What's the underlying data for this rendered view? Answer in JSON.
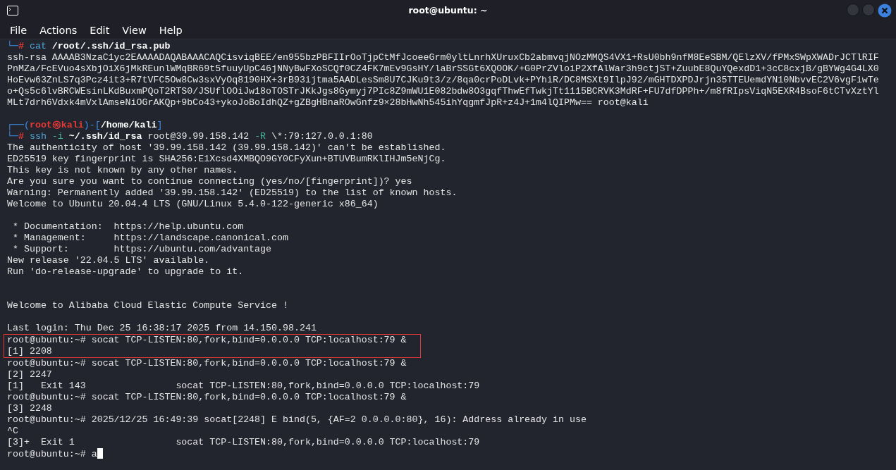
{
  "window": {
    "title": "root@ubuntu: ~"
  },
  "menu": [
    "File",
    "Actions",
    "Edit",
    "View",
    "Help"
  ],
  "terminal": {
    "cursor": true,
    "lines": [
      {
        "kind": "text",
        "highlighted": false,
        "segments": [
          {
            "kind": "frame",
            "text": "└─"
          },
          {
            "kind": "hash",
            "text": "# "
          },
          {
            "kind": "command",
            "text": "cat "
          },
          {
            "kind": "argument",
            "text": "/root/.ssh/id_rsa.pub"
          }
        ]
      },
      {
        "kind": "text",
        "highlighted": false,
        "segments": [
          {
            "kind": "plain",
            "text": "ssh-rsa AAAAB3NzaC1yc2EAAAADAQABAAACAQCisviqBEE/en955bzPBFIIrOoTjpCtMfJcoeeGrm0yltLnrhXUruxCb2abmvqjNOzMMQS4VX1+RsU0bh9nfM8EeSBM/QElzXV/fPMxSWpXWADrJCTlRIF"
          }
        ]
      },
      {
        "kind": "text",
        "highlighted": false,
        "segments": [
          {
            "kind": "plain",
            "text": "PnMZa/FcEVuo4sXbjOiX6jMkREunlWMqBR69t5fuuyUpC46jNNyBwFXoSCQf0CZ4FK7mEv9GsHY/laBrSSGt6XQOOK/+G0PrZVloiP2XfAlWar3h9ctjST+ZuubE8QuYQexdD1+3cC8cxjB/gBYWg4G4LX0"
          }
        ]
      },
      {
        "kind": "text",
        "highlighted": false,
        "segments": [
          {
            "kind": "plain",
            "text": "HoEvw63ZnLS7q3Pcz4it3+R7tVFC5Ow8Cw3sxVyOq8190HX+3rB93ijtma5AADLesSm8U7CJKu9t3/z/8qa0crPoDLvk+PYhiR/DC8MSXt9IlpJ92/mGHTDXPDJrjn35TTEUemdYN10NbvvEC2V6vgFiwTe"
          }
        ]
      },
      {
        "kind": "text",
        "highlighted": false,
        "segments": [
          {
            "kind": "plain",
            "text": "o+Qs5c6lvBRCWEsinLKdBuxmPQoT2RTS0/JSUflOOiJw18oTOSTrJKkJgs8Gymyj7PIc8Z9mWU1E082bdw8O3gqfThwEfTwkjTt1115BCRVK3MdRF+FU7dfDPPh+/m8fRIpsViqN5EXR4BsoF6tCTvXztYl"
          }
        ]
      },
      {
        "kind": "text",
        "highlighted": false,
        "segments": [
          {
            "kind": "plain",
            "text": "MLt7drh6Vdxk4mVxlAmseNiOGrAKQp+9bCo43+ykoJoBoIdhQZ+gZBgHBnaROwGnfz9×28bHwNh545ihYqgmfJpR+z4J+1m4lQIPMw== root@kali"
          }
        ]
      },
      {
        "kind": "blank",
        "highlighted": false
      },
      {
        "kind": "text",
        "highlighted": false,
        "segments": [
          {
            "kind": "frame",
            "text": "┌──("
          },
          {
            "kind": "user",
            "text": "root㉿kali"
          },
          {
            "kind": "frame",
            "text": ")-["
          },
          {
            "kind": "argument",
            "text": "/home/kali"
          },
          {
            "kind": "frame",
            "text": "]"
          }
        ]
      },
      {
        "kind": "text",
        "highlighted": false,
        "segments": [
          {
            "kind": "frame",
            "text": "└─"
          },
          {
            "kind": "hash",
            "text": "# "
          },
          {
            "kind": "command",
            "text": "ssh "
          },
          {
            "kind": "option",
            "text": "-i "
          },
          {
            "kind": "argument",
            "text": "~/.ssh/id_rsa"
          },
          {
            "kind": "plain",
            "text": " root@39.99.158.142 "
          },
          {
            "kind": "option",
            "text": "-R "
          },
          {
            "kind": "plain",
            "text": "\\*:79:127.0.0.1:80"
          }
        ]
      },
      {
        "kind": "text",
        "highlighted": false,
        "segments": [
          {
            "kind": "plain",
            "text": "The authenticity of host '39.99.158.142 (39.99.158.142)' can't be established."
          }
        ]
      },
      {
        "kind": "text",
        "highlighted": false,
        "segments": [
          {
            "kind": "plain",
            "text": "ED25519 key fingerprint is SHA256:E1Xcsd4XMBQO9GY0CFyXun+BTUVBumRKlIHJm5eNjCg."
          }
        ]
      },
      {
        "kind": "text",
        "highlighted": false,
        "segments": [
          {
            "kind": "plain",
            "text": "This key is not known by any other names."
          }
        ]
      },
      {
        "kind": "text",
        "highlighted": false,
        "segments": [
          {
            "kind": "plain",
            "text": "Are you sure you want to continue connecting (yes/no/[fingerprint])? yes"
          }
        ]
      },
      {
        "kind": "text",
        "highlighted": false,
        "segments": [
          {
            "kind": "plain",
            "text": "Warning: Permanently added '39.99.158.142' (ED25519) to the list of known hosts."
          }
        ]
      },
      {
        "kind": "text",
        "highlighted": false,
        "segments": [
          {
            "kind": "plain",
            "text": "Welcome to Ubuntu 20.04.4 LTS (GNU/Linux 5.4.0-122-generic x86_64)"
          }
        ]
      },
      {
        "kind": "blank",
        "highlighted": false
      },
      {
        "kind": "text",
        "highlighted": false,
        "segments": [
          {
            "kind": "plain",
            "text": " * Documentation:  https://help.ubuntu.com"
          }
        ]
      },
      {
        "kind": "text",
        "highlighted": false,
        "segments": [
          {
            "kind": "plain",
            "text": " * Management:     https://landscape.canonical.com"
          }
        ]
      },
      {
        "kind": "text",
        "highlighted": false,
        "segments": [
          {
            "kind": "plain",
            "text": " * Support:        https://ubuntu.com/advantage"
          }
        ]
      },
      {
        "kind": "text",
        "highlighted": false,
        "segments": [
          {
            "kind": "plain",
            "text": "New release '22.04.5 LTS' available."
          }
        ]
      },
      {
        "kind": "text",
        "highlighted": false,
        "segments": [
          {
            "kind": "plain",
            "text": "Run 'do-release-upgrade' to upgrade to it."
          }
        ]
      },
      {
        "kind": "blank",
        "highlighted": false
      },
      {
        "kind": "blank",
        "highlighted": false
      },
      {
        "kind": "text",
        "highlighted": false,
        "segments": [
          {
            "kind": "plain",
            "text": "Welcome to Alibaba Cloud Elastic Compute Service !"
          }
        ]
      },
      {
        "kind": "blank",
        "highlighted": false
      },
      {
        "kind": "text",
        "highlighted": false,
        "segments": [
          {
            "kind": "plain",
            "text": "Last login: Thu Dec 25 16:38:17 2025 from 14.150.98.241"
          }
        ]
      },
      {
        "kind": "text",
        "highlighted": true,
        "segments": [
          {
            "kind": "plain",
            "text": "root@ubuntu:~# socat TCP-LISTEN:80,fork,bind=0.0.0.0 TCP:localhost:79 &"
          }
        ]
      },
      {
        "kind": "text",
        "highlighted": true,
        "segments": [
          {
            "kind": "plain",
            "text": "[1] 2208"
          }
        ]
      },
      {
        "kind": "text",
        "highlighted": false,
        "segments": [
          {
            "kind": "plain",
            "text": "root@ubuntu:~# socat TCP-LISTEN:80,fork,bind=0.0.0.0 TCP:localhost:79 &"
          }
        ]
      },
      {
        "kind": "text",
        "highlighted": false,
        "segments": [
          {
            "kind": "plain",
            "text": "[2] 2247"
          }
        ]
      },
      {
        "kind": "text",
        "highlighted": false,
        "segments": [
          {
            "kind": "plain",
            "text": "[1]   Exit 143                socat TCP-LISTEN:80,fork,bind=0.0.0.0 TCP:localhost:79"
          }
        ]
      },
      {
        "kind": "text",
        "highlighted": false,
        "segments": [
          {
            "kind": "plain",
            "text": "root@ubuntu:~# socat TCP-LISTEN:80,fork,bind=0.0.0.0 TCP:localhost:79 &"
          }
        ]
      },
      {
        "kind": "text",
        "highlighted": false,
        "segments": [
          {
            "kind": "plain",
            "text": "[3] 2248"
          }
        ]
      },
      {
        "kind": "text",
        "highlighted": false,
        "segments": [
          {
            "kind": "plain",
            "text": "root@ubuntu:~# 2025/12/25 16:49:39 socat[2248] E bind(5, {AF=2 0.0.0.0:80}, 16): Address already in use"
          }
        ]
      },
      {
        "kind": "text",
        "highlighted": false,
        "segments": [
          {
            "kind": "plain",
            "text": "^C"
          }
        ]
      },
      {
        "kind": "text",
        "highlighted": false,
        "segments": [
          {
            "kind": "plain",
            "text": "[3]+  Exit 1                  socat TCP-LISTEN:80,fork,bind=0.0.0.0 TCP:localhost:79"
          }
        ]
      },
      {
        "kind": "text",
        "highlighted": false,
        "segments": [
          {
            "kind": "plain",
            "text": "root@ubuntu:~# a"
          }
        ]
      }
    ]
  }
}
